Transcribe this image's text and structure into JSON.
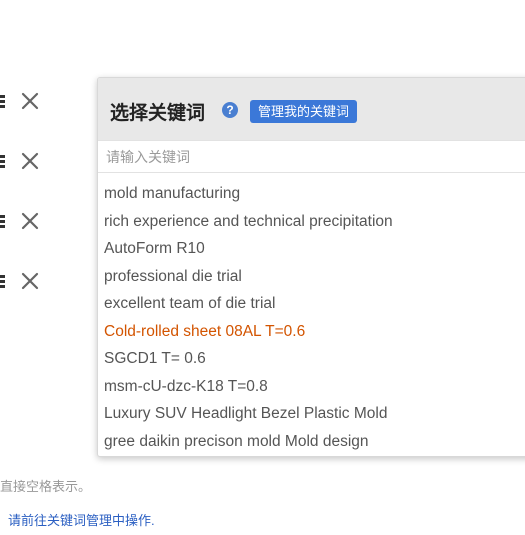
{
  "background": {
    "rows": [
      {
        "close_icon": "close-icon"
      },
      {
        "close_icon": "close-icon"
      },
      {
        "close_icon": "close-icon"
      },
      {
        "close_icon": "close-icon"
      }
    ],
    "hint_text": "直接空格表示。",
    "manage_link_text": "请前往关键词管理中操作."
  },
  "popup": {
    "title": "选择关键词",
    "help_icon_glyph": "?",
    "manage_button_label": "管理我的关键词",
    "search_placeholder": "请输入关键词",
    "search_value": "",
    "active_color": "#d35400",
    "keywords": [
      {
        "label": "mold manufacturing",
        "active": false
      },
      {
        "label": "rich experience and technical precipitation",
        "active": false
      },
      {
        "label": "AutoForm R10",
        "active": false
      },
      {
        "label": "professional die trial",
        "active": false
      },
      {
        "label": "excellent team of die trial",
        "active": false
      },
      {
        "label": "Cold-rolled sheet 08AL T=0.6",
        "active": true
      },
      {
        "label": "SGCD1 T= 0.6",
        "active": false
      },
      {
        "label": "msm-cU-dzc-K18 T=0.8",
        "active": false
      },
      {
        "label": "Luxury SUV Headlight Bezel Plastic Mold",
        "active": false
      },
      {
        "label": "gree daikin precison mold Mold design",
        "active": false
      }
    ]
  }
}
